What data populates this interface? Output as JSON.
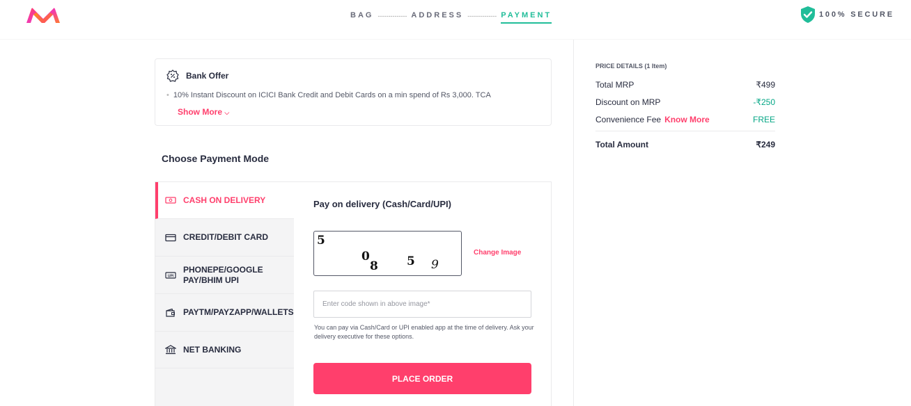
{
  "header": {
    "steps": [
      "BAG",
      "ADDRESS",
      "PAYMENT"
    ],
    "dots": "--------------",
    "secure_label": "100% SECURE"
  },
  "offer": {
    "title": "Bank Offer",
    "text": "10% Instant Discount on ICICI Bank Credit and Debit Cards on a min spend of Rs 3,000. TCA",
    "show_more": "Show More"
  },
  "payment": {
    "heading": "Choose Payment Mode",
    "tabs": [
      {
        "label": "CASH ON DELIVERY",
        "icon": "cash-icon"
      },
      {
        "label": "CREDIT/DEBIT CARD",
        "icon": "card-icon"
      },
      {
        "label": "PHONEPE/GOOGLE PAY/BHIM UPI",
        "icon": "upi-icon"
      },
      {
        "label": "PAYTM/PAYZAPP/WALLETS",
        "icon": "wallet-icon"
      },
      {
        "label": "NET BANKING",
        "icon": "bank-icon"
      }
    ],
    "pod_title": "Pay on delivery (Cash/Card/UPI)",
    "captcha_chars": [
      "5",
      "0",
      "8",
      "5",
      "9"
    ],
    "change_image": "Change Image",
    "code_placeholder": "Enter code shown in above image*",
    "note": "You can pay via Cash/Card or UPI enabled app at the time of delivery. Ask your delivery executive for these options.",
    "place_order": "PLACE ORDER"
  },
  "price_details": {
    "heading": "PRICE DETAILS (1 Item)",
    "rows": [
      {
        "label": "Total MRP",
        "value": "₹499"
      },
      {
        "label": "Discount on MRP",
        "value": "-₹250"
      },
      {
        "label": "Convenience Fee",
        "link": "Know More",
        "value": "FREE"
      }
    ],
    "total_label": "Total Amount",
    "total_value": "₹249"
  },
  "colors": {
    "accent": "#ff3f6c",
    "green": "#03a685",
    "step_active": "#20bd99"
  }
}
